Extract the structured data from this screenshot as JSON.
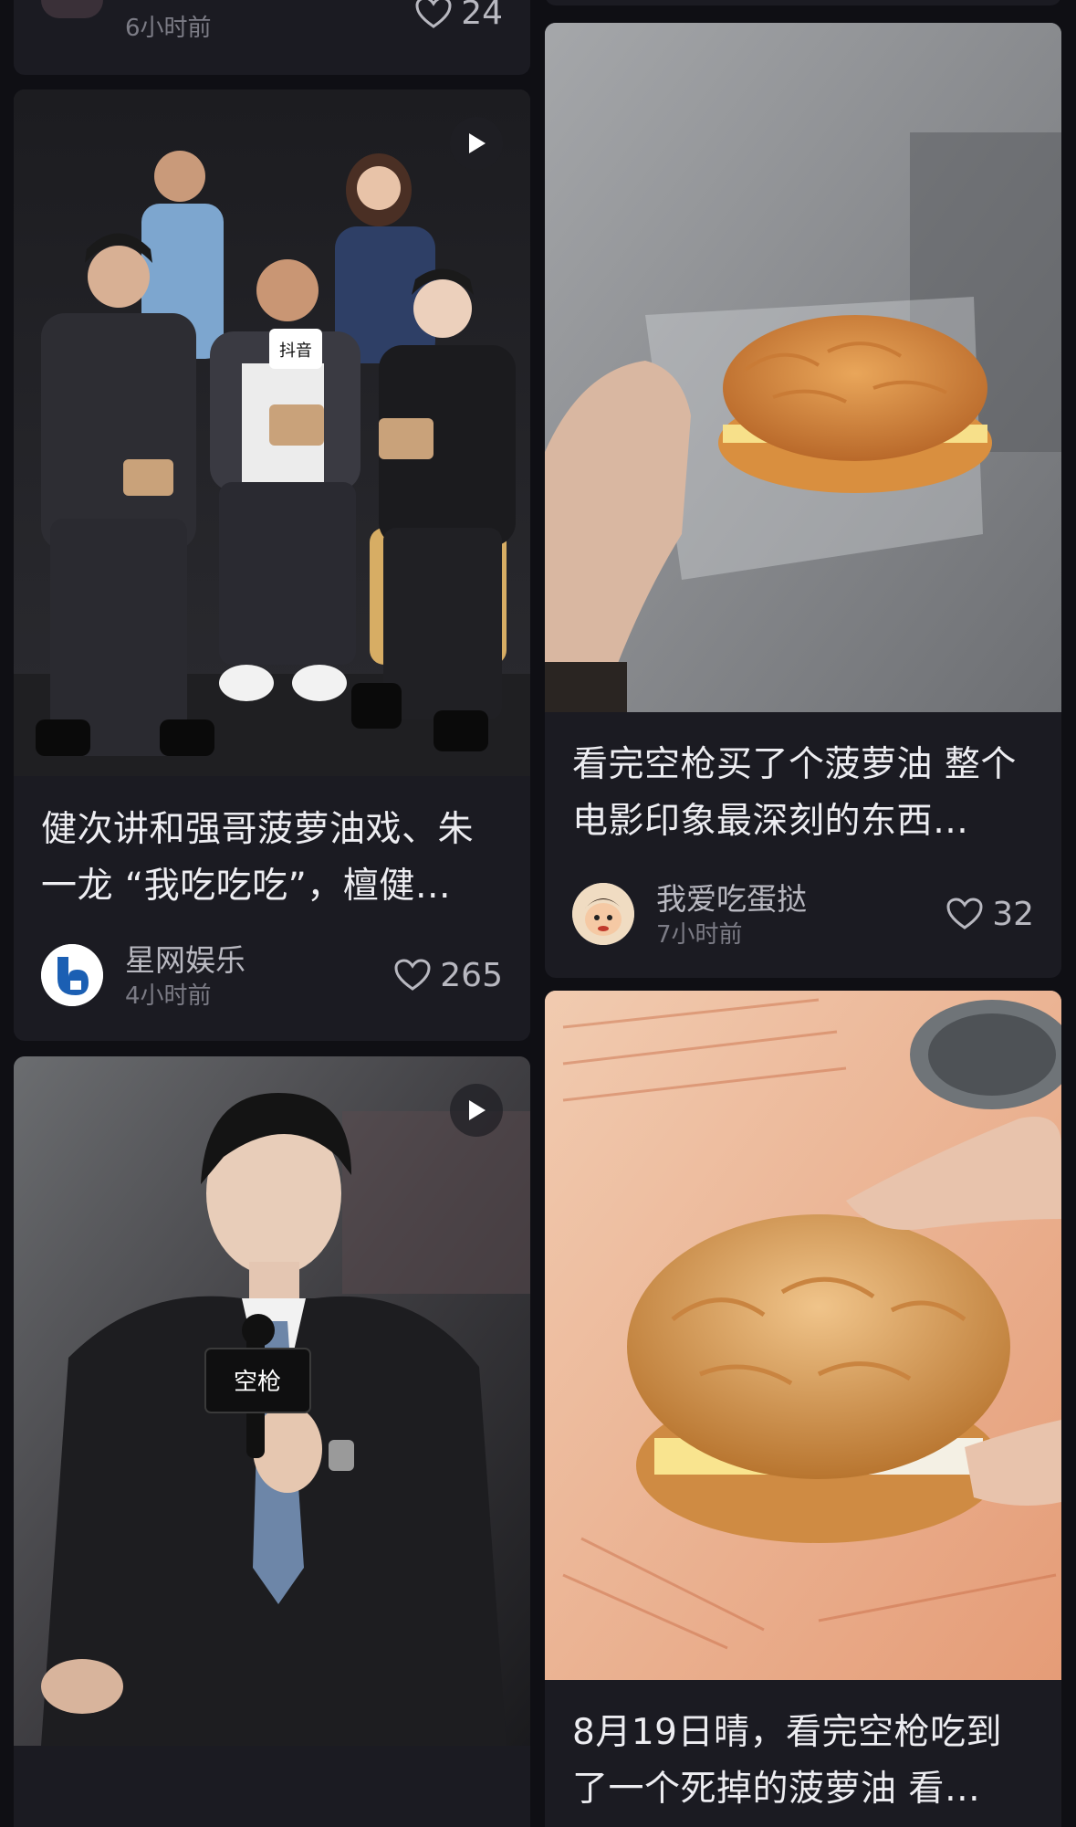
{
  "feed": {
    "top_partial_card": {
      "time": "6小时前",
      "likes": "24"
    },
    "cards": [
      {
        "title": "健次讲和强哥菠萝油戏、朱一龙 “我吃吃吃”，檀健…",
        "author": "星网娱乐",
        "time": "4小时前",
        "likes": "265",
        "is_video": true,
        "image_icon": "group-photo-icon",
        "overlay_text": "抖音"
      },
      {
        "title": "看完空枪买了个菠萝油 整个电影印象最深刻的东西…",
        "author": "我爱吃蛋挞",
        "time": "7小时前",
        "likes": "32",
        "is_video": false,
        "image_icon": "pineapple-bun-icon"
      },
      {
        "is_video": true,
        "image_icon": "speaker-with-microphone-icon",
        "mic_label": "空枪"
      },
      {
        "title": "8月19日晴，看完空枪吃到了一个死掉的菠萝油 看…",
        "is_video": false,
        "image_icon": "pineapple-bun-icon"
      }
    ]
  },
  "colors": {
    "background": "#0f0f14",
    "card": "#1b1b22",
    "title_text": "#ededf1",
    "meta_text": "#b8b8c0",
    "muted_text": "#7c7c86"
  }
}
